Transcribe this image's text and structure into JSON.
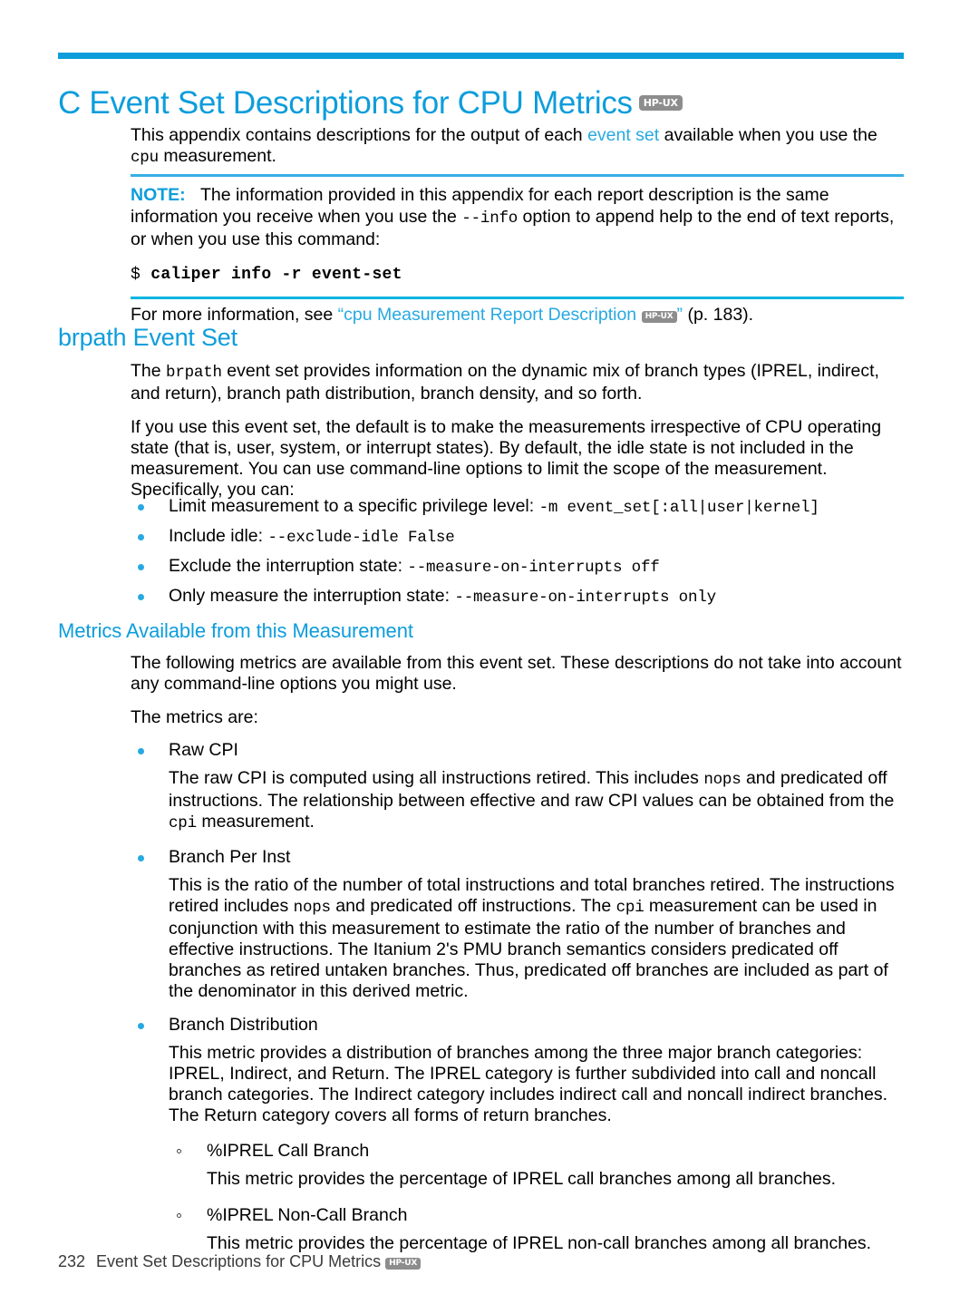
{
  "chapter": {
    "title": "C Event Set Descriptions for CPU Metrics",
    "badge": "HP-UX"
  },
  "intro": {
    "part1": "This appendix contains descriptions for the output of each ",
    "link": "event set",
    "part2": " available when you use the ",
    "code": "cpu",
    "part3": " measurement."
  },
  "note": {
    "label": "NOTE:",
    "text1": "The information provided in this appendix for each report description is the same information you receive when you use the ",
    "code1": "--info",
    "text2": " option to append help to the end of text reports, or when you use this command:",
    "prompt": "$",
    "command": "caliper info -r event-set"
  },
  "xref": {
    "prefix": "For more information, see ",
    "quote_open": "“",
    "link": "cpu Measurement Report Description",
    "badge": "HP-UX",
    "quote_close": "”",
    "suffix": " (p. 183)."
  },
  "brpath": {
    "heading": "brpath Event Set",
    "para1_a": "The ",
    "para1_code": "brpath",
    "para1_b": " event set provides information on the dynamic mix of branch types (IPREL, indirect, and return), branch path distribution, branch density, and so forth.",
    "para2": "If you use this event set, the default is to make the measurements irrespective of CPU operating state (that is, user, system, or interrupt states). By default, the idle state is not included in the measurement. You can use command-line options to limit the scope of the measurement. Specifically, you can:",
    "options": [
      {
        "label": "Limit measurement to a specific privilege level: ",
        "code": "-m event_set[:all|user|kernel]"
      },
      {
        "label": "Include idle: ",
        "code": "--exclude-idle False"
      },
      {
        "label": "Exclude the interruption state: ",
        "code": "--measure-on-interrupts off"
      },
      {
        "label": "Only measure the interruption state: ",
        "code": "--measure-on-interrupts only"
      }
    ]
  },
  "metrics_section": {
    "heading": "Metrics Available from this Measurement",
    "intro": "The following metrics are available from this event set. These descriptions do not take into account any command-line options you might use.",
    "lead": "The metrics are:",
    "items": [
      {
        "name": "Raw CPI",
        "desc_a": "The raw CPI is computed using all instructions retired. This includes ",
        "desc_code1": "nops",
        "desc_b": " and predicated off instructions. The relationship between effective and raw CPI values can be obtained from the ",
        "desc_code2": "cpi",
        "desc_c": " measurement."
      },
      {
        "name": "Branch Per Inst",
        "desc_a": "This is the ratio of the number of total instructions and total branches retired. The instructions retired includes ",
        "desc_code1": "nops",
        "desc_b": " and predicated off instructions. The ",
        "desc_code2": "cpi",
        "desc_c": " measurement can be used in conjunction with this measurement to estimate the ratio of the number of branches and effective instructions. The Itanium 2's PMU branch semantics considers predicated off branches as retired untaken branches. Thus, predicated off branches are included as part of the denominator in this derived metric."
      },
      {
        "name": "Branch Distribution",
        "desc_a": "This metric provides a distribution of branches among the three major branch categories: IPREL, Indirect, and Return. The IPREL category is further subdivided into call and noncall branch categories. The Indirect category includes indirect call and noncall indirect branches. The Return category covers all forms of return branches.",
        "subitems": [
          {
            "name": "%IPREL Call Branch",
            "desc": "This metric provides the percentage of IPREL call branches among all branches."
          },
          {
            "name": "%IPREL Non-Call Branch",
            "desc": "This metric provides the percentage of IPREL non-call branches among all branches."
          }
        ]
      }
    ]
  },
  "footer": {
    "page_number": "232",
    "text": "Event Set Descriptions for CPU Metrics",
    "badge": "HP-UX"
  },
  "colors": {
    "accent_blue": "#0d9ddb",
    "link_blue": "#27a9e1",
    "badge_gray": "#8d8d8d"
  }
}
